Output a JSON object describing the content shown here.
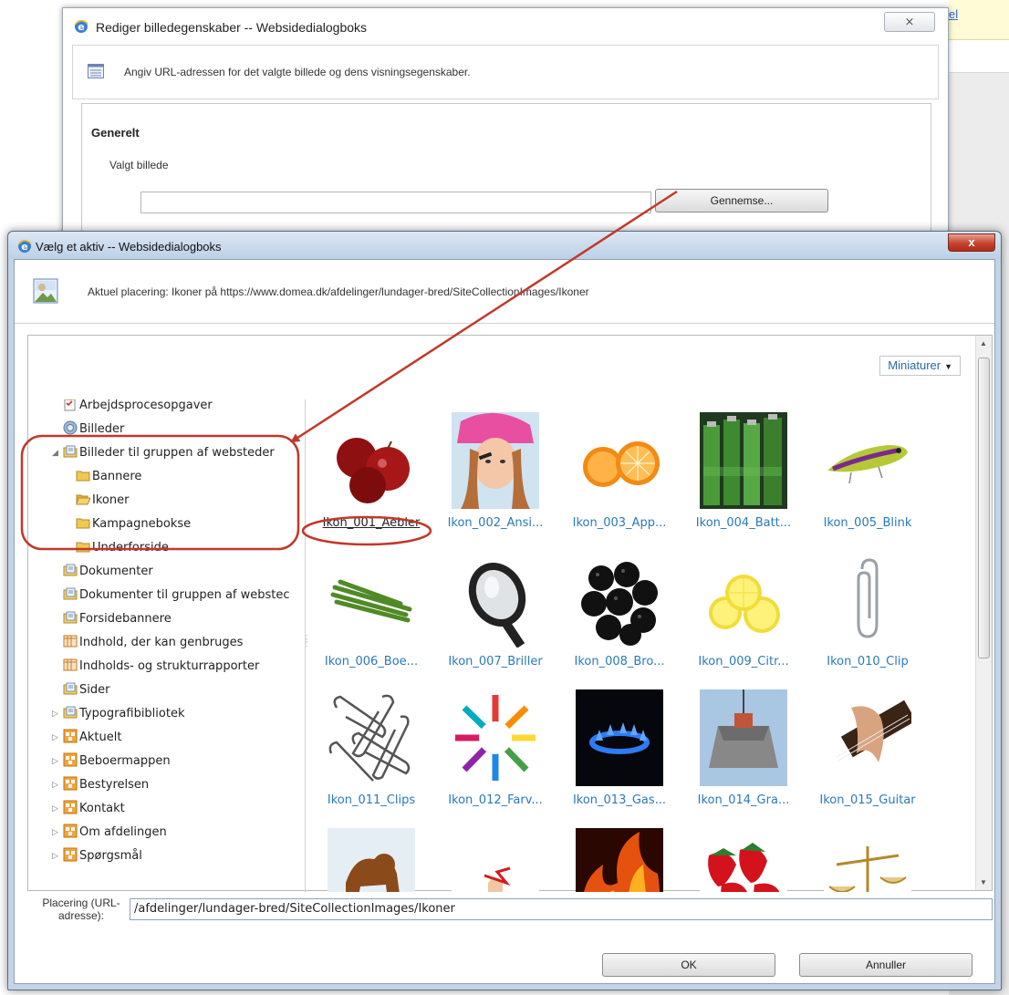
{
  "background": {
    "link_text": "el"
  },
  "dialog_edit": {
    "title": "Rediger billedegenskaber -- Websidedialogboks",
    "close_glyph": "⨯",
    "description": "Angiv URL-adressen for det valgte billede og dens visningsegenskaber.",
    "section_title": "Generelt",
    "field_label": "Valgt billede",
    "field_value": "",
    "browse_button": "Gennemse..."
  },
  "dialog_asset": {
    "title": "Vælg et aktiv -- Websidedialogboks",
    "close_glyph": "x",
    "location_text": "Aktuel placering: Ikoner på https://www.domea.dk/afdelinger/lundager-bred/SiteCollectionImages/Ikoner",
    "view_mode": "Miniaturer",
    "tree": [
      {
        "label": "Arbejdsprocesopgaver",
        "icon": "tasks-icon"
      },
      {
        "label": "Billeder",
        "icon": "images-library-icon"
      },
      {
        "label": "Billeder til gruppen af websteder",
        "icon": "doc-library-icon"
      },
      {
        "label": "Bannere",
        "icon": "folder-icon"
      },
      {
        "label": "Ikoner",
        "icon": "folder-open-icon"
      },
      {
        "label": "Kampagnebokse",
        "icon": "folder-icon"
      },
      {
        "label": "Underforside",
        "icon": "folder-icon"
      },
      {
        "label": "Dokumenter",
        "icon": "doc-library-icon"
      },
      {
        "label": "Dokumenter til gruppen af webstec",
        "icon": "doc-library-icon"
      },
      {
        "label": "Forsidebannere",
        "icon": "doc-library-icon"
      },
      {
        "label": "Indhold, der kan genbruges",
        "icon": "list-icon"
      },
      {
        "label": "Indholds- og strukturrapporter",
        "icon": "list-icon"
      },
      {
        "label": "Sider",
        "icon": "doc-library-icon"
      },
      {
        "label": "Typografibibliotek",
        "icon": "doc-library-icon"
      },
      {
        "label": "Aktuelt",
        "icon": "subsite-icon"
      },
      {
        "label": "Beboermappen",
        "icon": "subsite-icon"
      },
      {
        "label": "Bestyrelsen",
        "icon": "subsite-icon"
      },
      {
        "label": "Kontakt",
        "icon": "subsite-icon"
      },
      {
        "label": "Om afdelingen",
        "icon": "subsite-icon"
      },
      {
        "label": "Spørgsmål",
        "icon": "subsite-icon"
      }
    ],
    "thumbnails": [
      {
        "caption": "Ikon_001_Aebler",
        "subject": "apples"
      },
      {
        "caption": "Ikon_002_Ansi...",
        "subject": "girl-makeup"
      },
      {
        "caption": "Ikon_003_App...",
        "subject": "oranges"
      },
      {
        "caption": "Ikon_004_Batt...",
        "subject": "batteries"
      },
      {
        "caption": "Ikon_005_Blink",
        "subject": "fishing-lure"
      },
      {
        "caption": "Ikon_006_Boe...",
        "subject": "green-beans"
      },
      {
        "caption": "Ikon_007_Briller",
        "subject": "goggles"
      },
      {
        "caption": "Ikon_008_Bro...",
        "subject": "blackberries"
      },
      {
        "caption": "Ikon_009_Citr...",
        "subject": "lemon-slices"
      },
      {
        "caption": "Ikon_010_Clip",
        "subject": "paper-clip"
      },
      {
        "caption": "Ikon_011_Clips",
        "subject": "paper-clips"
      },
      {
        "caption": "Ikon_012_Farv...",
        "subject": "colored-pencils"
      },
      {
        "caption": "Ikon_013_Gas...",
        "subject": "gas-flame"
      },
      {
        "caption": "Ikon_014_Gra...",
        "subject": "grab-bucket"
      },
      {
        "caption": "Ikon_015_Guitar",
        "subject": "guitar-hand"
      },
      {
        "caption": "",
        "subject": "dog-snow"
      },
      {
        "caption": "",
        "subject": "finger-string"
      },
      {
        "caption": "",
        "subject": "fire"
      },
      {
        "caption": "",
        "subject": "strawberries"
      },
      {
        "caption": "",
        "subject": "scales"
      }
    ],
    "url_label": "Placering (URL-adresse):",
    "url_value": "/afdelinger/lundager-bred/SiteCollectionImages/Ikoner",
    "ok_button": "OK",
    "cancel_button": "Annuller"
  },
  "colors": {
    "link_blue": "#2a7ab8",
    "annotation_red": "#c0392b",
    "title_bar_blue": "#c4d4e7"
  }
}
